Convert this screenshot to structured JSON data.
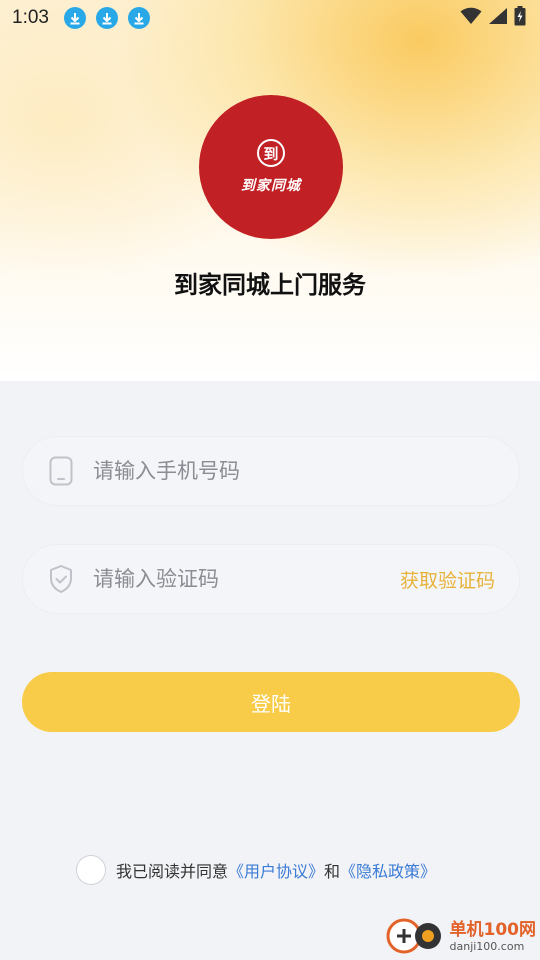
{
  "status_bar": {
    "time": "1:03",
    "icons": [
      "download-icon",
      "download-icon",
      "download-icon",
      "wifi-icon",
      "signal-icon",
      "battery-icon"
    ]
  },
  "brand": {
    "logo_mark": "到",
    "logo_text": "到家同城",
    "title": "到家同城上门服务",
    "logo_color": "#c12024"
  },
  "form": {
    "phone_placeholder": "请输入手机号码",
    "code_placeholder": "请输入验证码",
    "get_code_label": "获取验证码",
    "login_label": "登陆"
  },
  "agreement": {
    "prefix": "我已阅读并同意",
    "user_agreement": "《用户协议》",
    "conjunction": "和",
    "privacy_policy": "《隐私政策》",
    "checked": false
  },
  "watermark": {
    "main": "单机100网",
    "sub": "danji100.com"
  },
  "colors": {
    "accent": "#f8cb48",
    "link": "#3a7bd5",
    "get_code": "#e7b23a"
  }
}
